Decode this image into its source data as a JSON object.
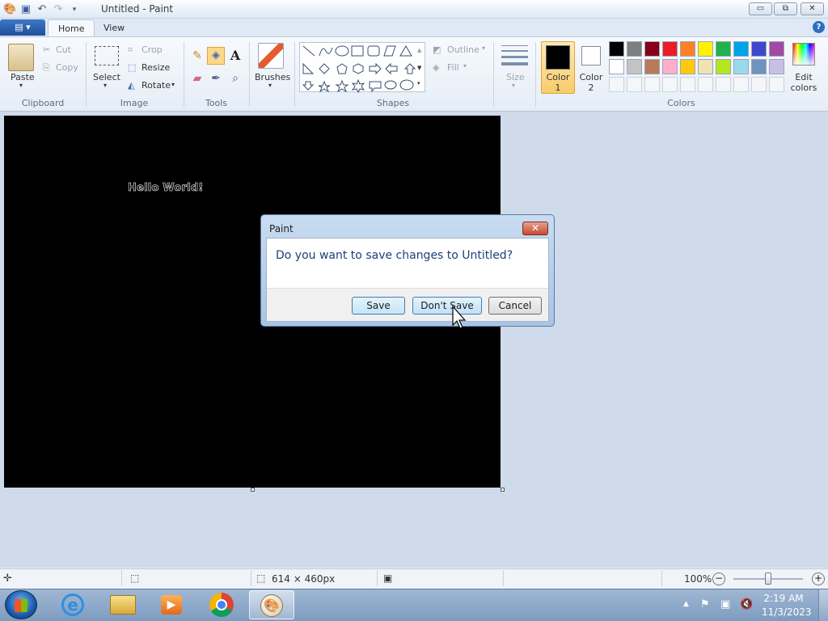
{
  "window": {
    "title": "Untitled - Paint",
    "minimize": "▭",
    "restore": "⧉",
    "close": "✕"
  },
  "qat": {
    "save_icon": "floppy-icon",
    "undo_icon": "undo-icon",
    "redo_icon": "redo-icon",
    "customize_icon": "dropdown-icon"
  },
  "tabs": {
    "file": "▤ ▾",
    "home": "Home",
    "view": "View"
  },
  "help": "?",
  "clipboard": {
    "paste": "Paste",
    "cut": "Cut",
    "copy": "Copy",
    "label": "Clipboard"
  },
  "image": {
    "select": "Select",
    "crop": "Crop",
    "resize": "Resize",
    "rotate": "Rotate",
    "label": "Image"
  },
  "tools": {
    "label": "Tools",
    "text_tool": "A"
  },
  "brushes": {
    "label": "Brushes"
  },
  "shapes": {
    "outline": "Outline",
    "fill": "Fill",
    "label": "Shapes"
  },
  "size": {
    "label": "Size"
  },
  "colors": {
    "color1": "Color 1",
    "color2": "Color 2",
    "edit": "Edit colors",
    "label": "Colors",
    "color1_value": "#000000",
    "color2_value": "#ffffff",
    "palette_row1": [
      "#000000",
      "#7f7f7f",
      "#880015",
      "#ed1c24",
      "#ff7f27",
      "#fff200",
      "#22b14c",
      "#00a2e8",
      "#3f48cc",
      "#a349a4"
    ],
    "palette_row2": [
      "#ffffff",
      "#c3c3c3",
      "#b97a57",
      "#ffaec9",
      "#ffc90e",
      "#efe4b0",
      "#b5e61d",
      "#99d9ea",
      "#7092be",
      "#c8bfe7"
    ]
  },
  "canvas": {
    "text": "Hello World!",
    "background": "#000000"
  },
  "dialog": {
    "title": "Paint",
    "message": "Do you want to save changes to Untitled?",
    "save": "Save",
    "dont_save": "Don't Save",
    "cancel": "Cancel",
    "close": "✕"
  },
  "status": {
    "dimensions": "614 × 460px",
    "zoom": "100%",
    "zoom_out": "−",
    "zoom_in": "+",
    "zoom_level_fraction": 0.5
  },
  "taskbar": {
    "time": "2:19 AM",
    "date": "11/3/2023"
  }
}
